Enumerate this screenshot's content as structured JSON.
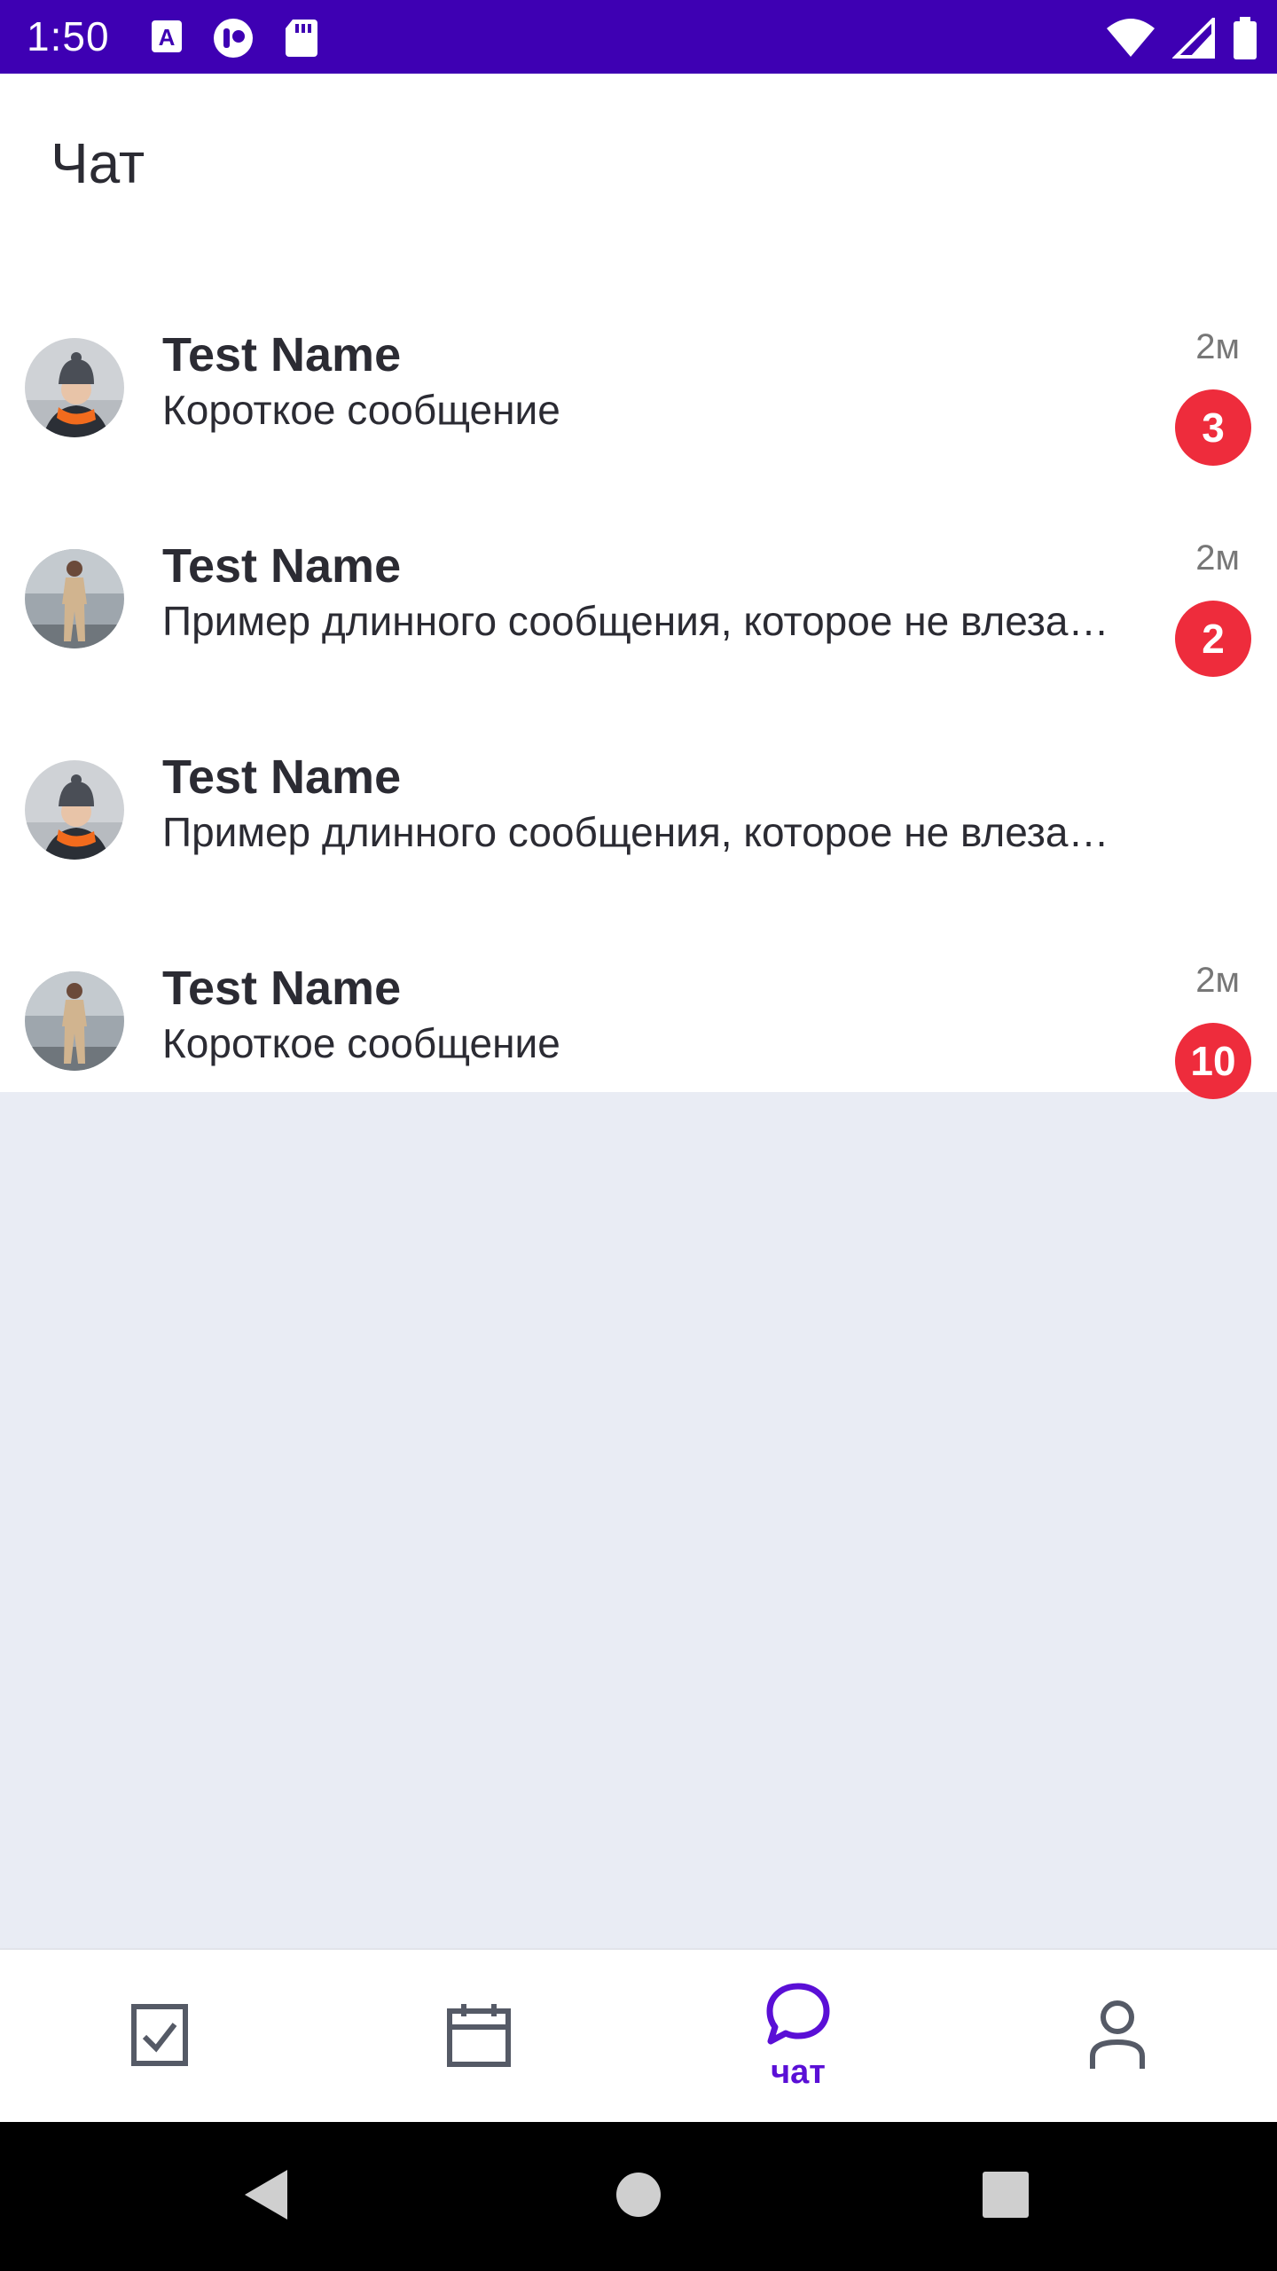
{
  "status_bar": {
    "time": "1:50",
    "left_icons": [
      "text-a-icon",
      "app-circle-icon",
      "sd-card-icon"
    ],
    "right_icons": [
      "wifi-icon",
      "cell-signal-icon",
      "battery-icon"
    ]
  },
  "header": {
    "title": "Чат"
  },
  "chats": [
    {
      "name": "Test Name",
      "message": "Короткое сообщение",
      "time": "2м",
      "unread": "3",
      "avatar": "woman-hat-avatar"
    },
    {
      "name": "Test Name",
      "message": "Пример длинного сообщения, которое не влезает в одну строку",
      "time": "2м",
      "unread": "2",
      "avatar": "woman-standing-avatar"
    },
    {
      "name": "Test Name",
      "message": "Пример длинного сообщения, которое не влезает в одну строку",
      "time": "",
      "unread": "",
      "avatar": "woman-hat-avatar"
    },
    {
      "name": "Test Name",
      "message": "Короткое сообщение",
      "time": "2м",
      "unread": "10",
      "avatar": "woman-standing-avatar"
    }
  ],
  "bottom_nav": {
    "items": [
      {
        "icon": "checkbox-icon",
        "label": ""
      },
      {
        "icon": "calendar-icon",
        "label": ""
      },
      {
        "icon": "chat-bubble-icon",
        "label": "чат",
        "active": true
      },
      {
        "icon": "person-icon",
        "label": ""
      }
    ]
  },
  "colors": {
    "status_bar": "#3e00b3",
    "accent": "#5a0fd6",
    "badge": "#ee2c3c",
    "background": "#e9ecf4"
  }
}
